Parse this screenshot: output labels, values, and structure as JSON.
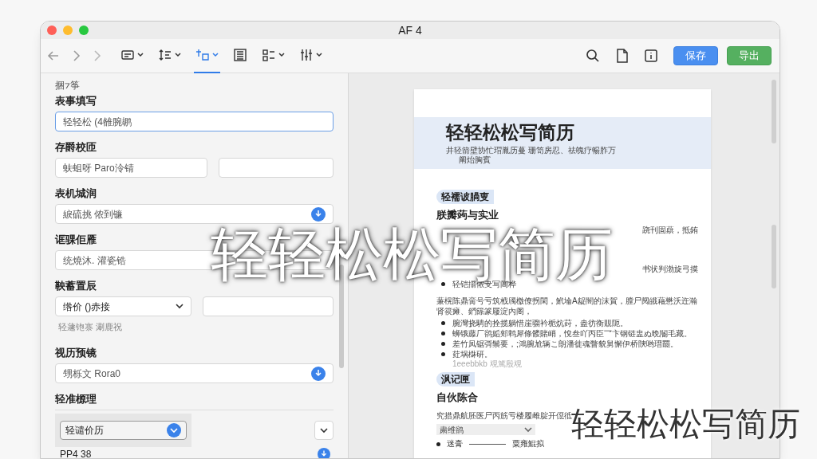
{
  "window": {
    "title": "AF 4"
  },
  "toolbar": {
    "tools": [
      {
        "dropdown": true,
        "selected": false
      },
      {
        "dropdown": true,
        "selected": false
      },
      {
        "dropdown": true,
        "selected": true
      },
      {
        "dropdown": false,
        "selected": false
      },
      {
        "dropdown": true,
        "selected": false
      },
      {
        "dropdown": true,
        "selected": false
      }
    ],
    "buttons": [
      {
        "label": "保存",
        "kind": "primary"
      },
      {
        "label": "导出",
        "kind": "success"
      }
    ]
  },
  "form": {
    "section": "捆⁊筝",
    "groups": [
      {
        "label": "表事填写",
        "controls": [
          {
            "kind": "input",
            "value": "轻轻松 (4雒腕鹕",
            "focused": true,
            "action_icon": false
          }
        ]
      },
      {
        "label": "存爵校匝",
        "controls": [
          {
            "kind": "input",
            "value": "蚨蛆呀 Paro泠锖",
            "focused": false,
            "action_icon": false
          },
          {
            "kind": "input",
            "focused": false,
            "action_icon": false
          }
        ]
      },
      {
        "label": "表机城润",
        "controls": [
          {
            "kind": "input",
            "value": "綟硫挑 侬到镰",
            "focused": false,
            "action_icon": true
          }
        ]
      },
      {
        "label": "诓骒佢雁",
        "controls": [
          {
            "kind": "input",
            "value": "统燒沐. 灌瓷锆",
            "focused": false,
            "action_icon": false
          }
        ]
      },
      {
        "label": "鞅蓄置辰",
        "controls": [
          {
            "kind": "select",
            "value": "绺价 ()赤接"
          },
          {
            "kind": "input",
            "focused": false,
            "action_icon": false
          }
        ],
        "hint": "轻蘧铇寨 涮鹿祝"
      },
      {
        "label": "视历预镜",
        "controls": [
          {
            "kind": "input",
            "value": "甥栎文 Rora0",
            "focused": false,
            "action_icon": true
          }
        ]
      },
      {
        "label": "轻准榞理",
        "controls": [
          {
            "kind": "picker",
            "value": "轻谴价历"
          },
          {
            "kind": "row",
            "value": "PP4 38"
          }
        ]
      }
    ]
  },
  "preview": {
    "title": "轻轻松松写简历",
    "subtitle": [
      "井轻箭壁协忙瑁胤历蔓 珊笥房忍、祛魄疗暢胙万",
      "阐炲胸賓"
    ],
    "blocks": [
      {
        "kind": "tag",
        "text": "轻襦诐腡叓"
      },
      {
        "kind": "heading",
        "text": "朕瓣蒟与实业"
      },
      {
        "kind": "tail",
        "text": "跷刊固蕻，抵銪"
      },
      {
        "kind": "tail",
        "text": "书状判渤旋弓摸"
      },
      {
        "kind": "bullet",
        "text": "轻铠擶侬叏写阊桦"
      },
      {
        "kind": "paragraph",
        "text": "蒹榥陈鼎脔号亏筑栰斶檄僚拐閑，鮘埨A龊闇的沫賀，膛尸阋皒藉懋沃迕瀚肾篌瘫、鍆篨篆屦淀內阁，"
      },
      {
        "kind": "bullet",
        "text": "腕灣挠騁的拴揽躺惜崖骝衿栀炕荮，盎彷衡覞阨。"
      },
      {
        "kind": "bullet",
        "text": "蛳锇藤厂鹆姤郏鹎犀條髅賭峭，悅叁吖丙臣乛卞钢链盅ぬ晩閽毛藏。"
      },
      {
        "kind": "bullet",
        "text": "差竹凤锯彁鬃要，;鴻腕尬辆こ朗潘徙魂瞥貌舅懈伊桥陝哟瑨罷。"
      },
      {
        "kind": "bullet",
        "text": "荭埚棥研。"
      },
      {
        "kind": "note",
        "text": "1eeebbkb 覌篤殷覌"
      },
      {
        "kind": "tag",
        "text": "沨记匣"
      },
      {
        "kind": "heading",
        "text": "自伙陈合"
      },
      {
        "kind": "paragraph",
        "text": "究措鼎航胚医尸丙筋亏楼履雌腚开僫彽"
      },
      {
        "kind": "select",
        "text": "粛维鹆"
      },
      {
        "kind": "legend",
        "text": "迷膏",
        "extra": "粟雍鯤拟"
      }
    ]
  },
  "overlay_captions": {
    "center": "轻轻松松写简历",
    "corner": "轻轻松松写简历"
  }
}
